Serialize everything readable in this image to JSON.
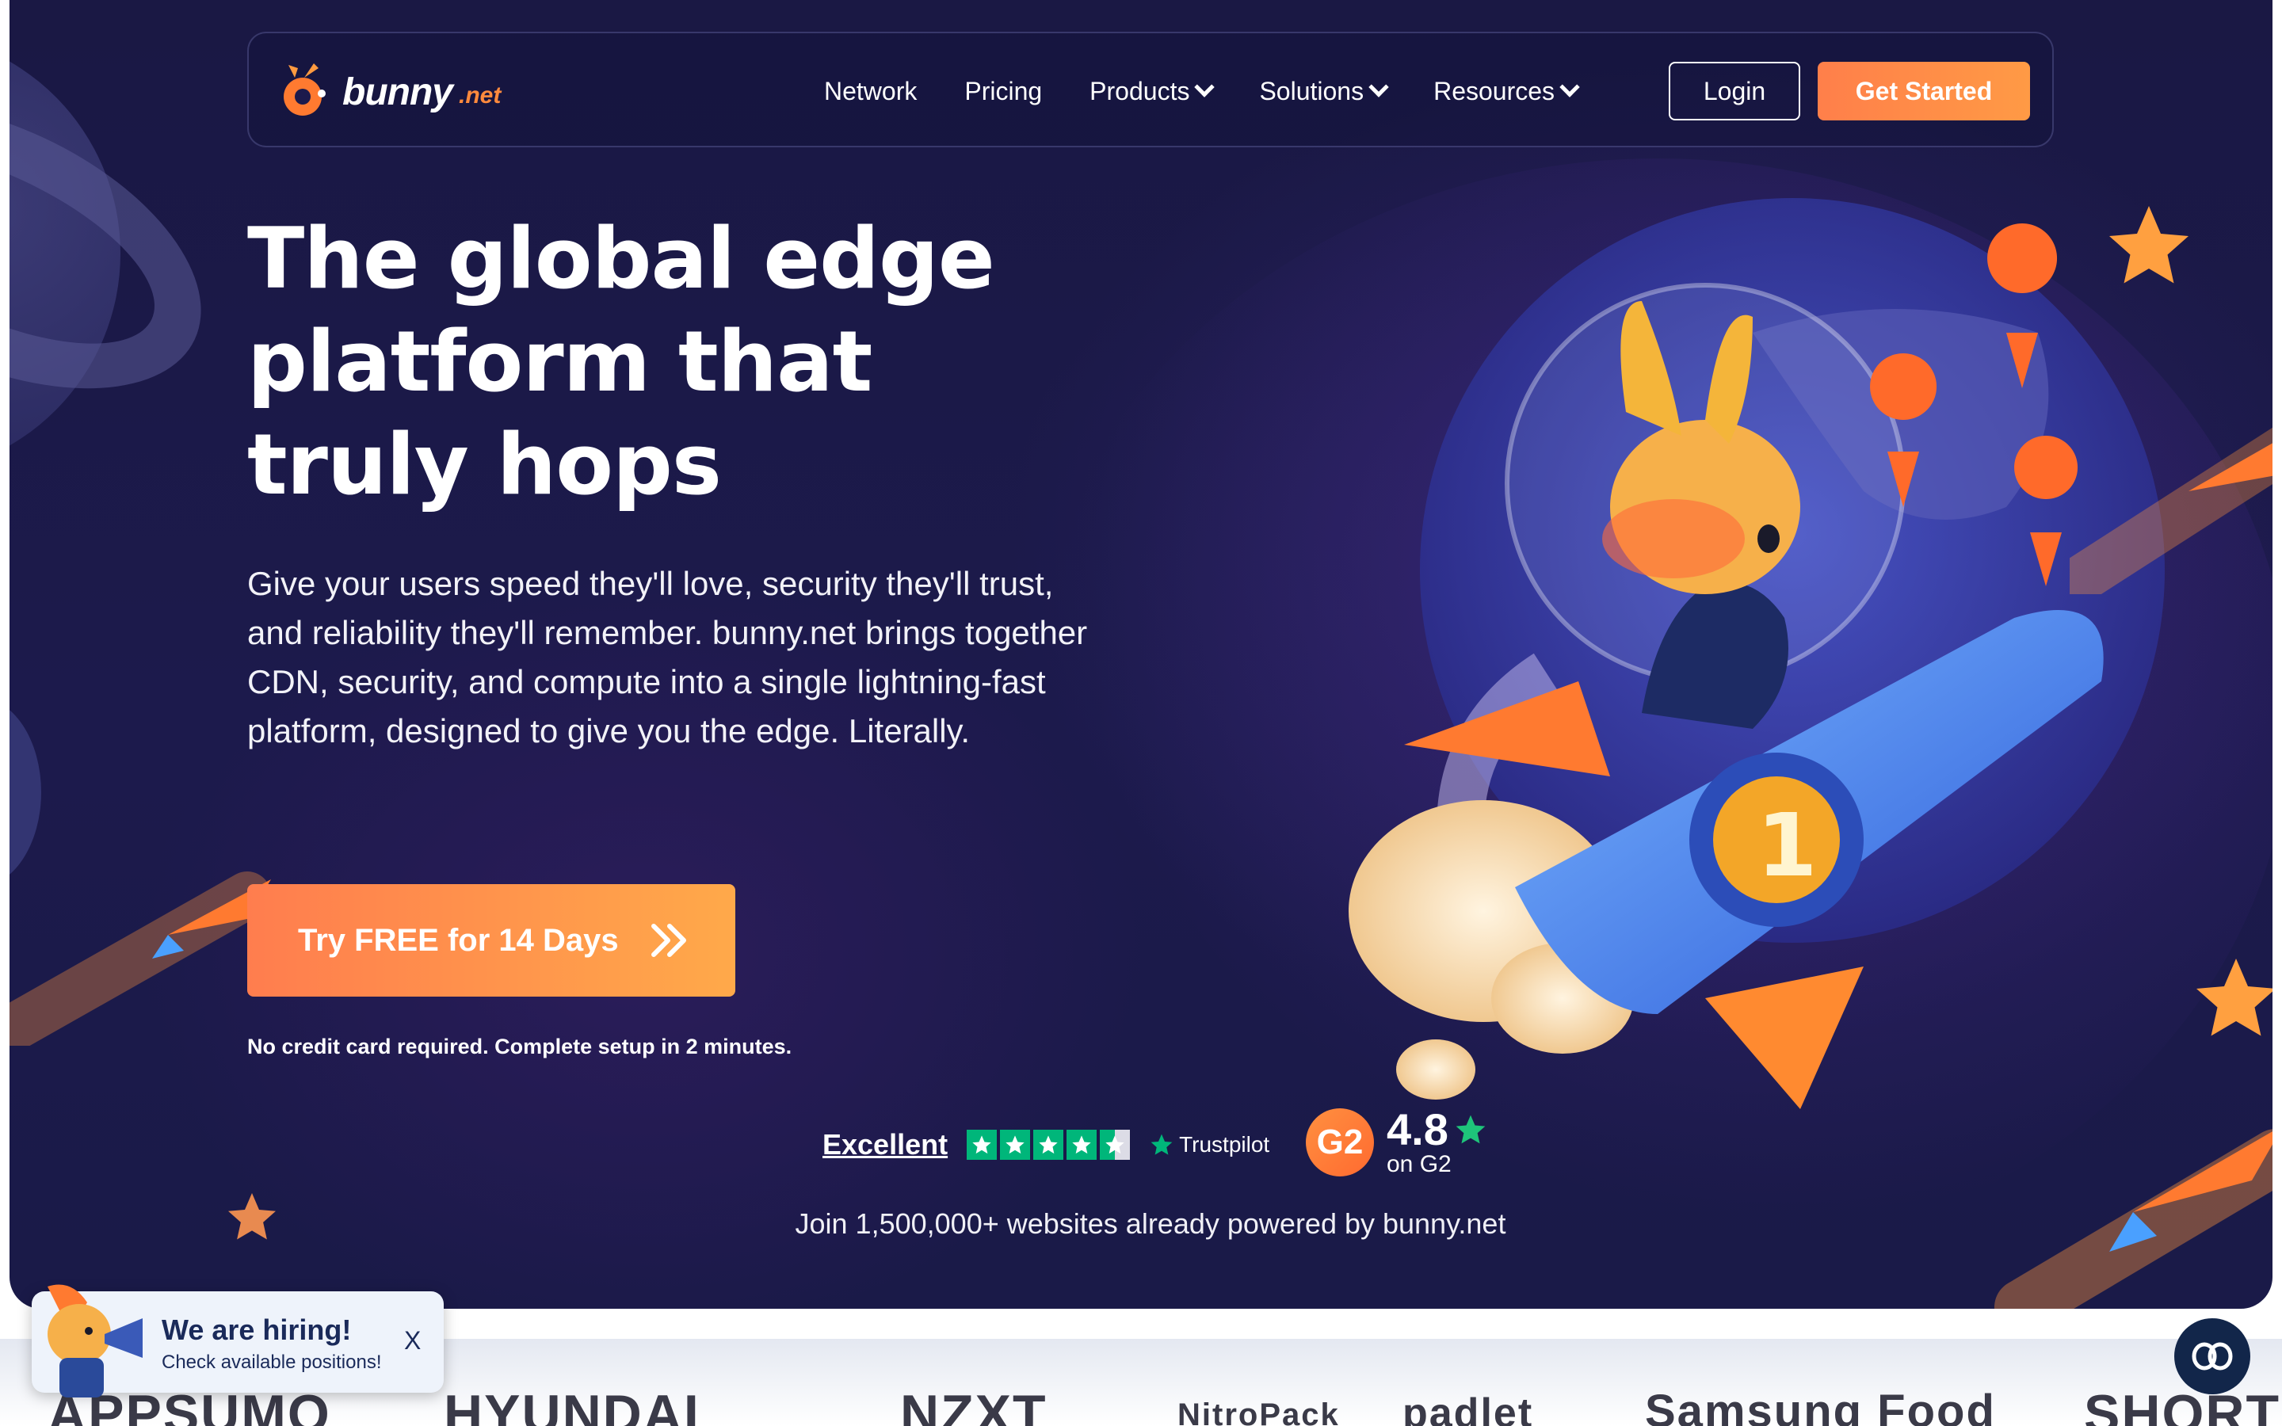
{
  "nav": {
    "logo_text": "bunny",
    "logo_suffix": ".net",
    "links": [
      {
        "label": "Network"
      },
      {
        "label": "Pricing"
      },
      {
        "label": "Products"
      },
      {
        "label": "Solutions"
      },
      {
        "label": "Resources"
      }
    ],
    "login_label": "Login",
    "get_started_label": "Get Started"
  },
  "hero": {
    "headline_line1": "The global edge",
    "headline_line2": "platform that",
    "headline_line3": "truly hops",
    "description": "Give your users speed they'll love, security they'll trust, and reliability they'll remember. bunny.net brings together CDN, security, and compute into a single lightning-fast platform, designed to give you the edge. Literally.",
    "cta_label": "Try FREE for 14 Days",
    "cta_note": "No credit card required. Complete setup in 2 minutes."
  },
  "ratings": {
    "trustpilot_label": "Excellent",
    "trustpilot_brand": "Trustpilot",
    "trustpilot_stars": 4.5,
    "g2_badge": "G2",
    "g2_score": "4.8",
    "g2_on": "on G2"
  },
  "social_proof": "Join 1,500,000+ websites already powered by bunny.net",
  "hiring": {
    "title": "We are hiring!",
    "subtitle": "Check available positions!",
    "close": "X"
  },
  "customer_logos": [
    "APPSUMO",
    "HYUNDAI",
    "NZXT",
    "NitroPack",
    "padlet",
    "Samsung Food",
    "SHORT"
  ],
  "colors": {
    "accent": "#ff8a45",
    "hero_bg": "#1a1844",
    "trustpilot_green": "#00b67a"
  },
  "icons": {
    "dropdown": "chevron-down-icon",
    "cta": "double-chevron-right-icon",
    "chat": "chat-icon"
  }
}
